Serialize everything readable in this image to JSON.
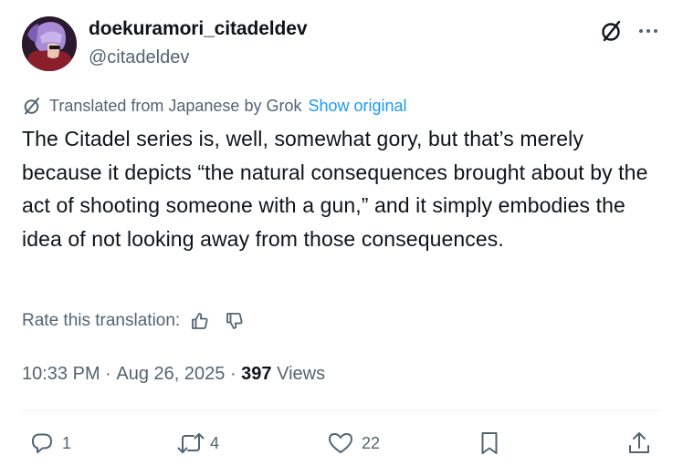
{
  "author": {
    "display_name": "doekuramori_citadeldev",
    "handle": "@citadeldev"
  },
  "translation": {
    "label": "Translated from Japanese by Grok",
    "show_original": "Show original"
  },
  "tweet": {
    "text": "The Citadel series is, well, somewhat gory, but that’s merely because it depicts “the natural consequences brought about by the act of shooting someone with a gun,” and it simply embodies the idea of not looking away from those consequences."
  },
  "rating": {
    "label": "Rate this translation:"
  },
  "meta": {
    "time": "10:33 PM",
    "separator": " · ",
    "date": "Aug 26, 2025",
    "views_count": "397",
    "views_label": " Views"
  },
  "actions": {
    "replies": "1",
    "reposts": "4",
    "likes": "22"
  },
  "icons": {
    "header": [
      "grok-icon",
      "more-icon"
    ],
    "rating": [
      "thumbs-up-icon",
      "thumbs-down-icon"
    ],
    "actions": [
      "reply-icon",
      "repost-icon",
      "like-icon",
      "bookmark-icon",
      "share-icon"
    ]
  },
  "colors": {
    "text_primary": "#0f1419",
    "text_secondary": "#536471",
    "link": "#1d9bf0",
    "divider": "#eff3f4"
  }
}
